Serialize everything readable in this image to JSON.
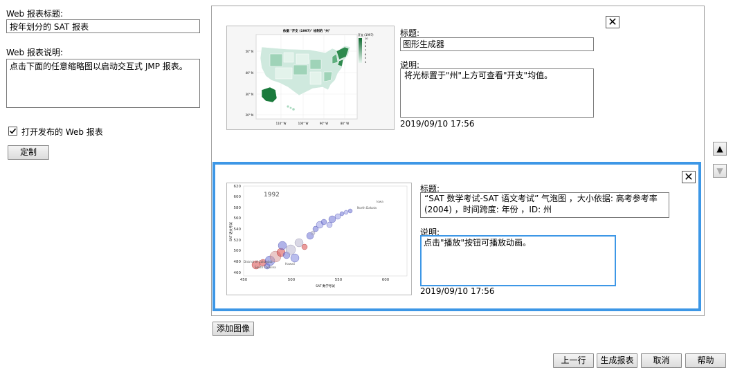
{
  "left": {
    "title_label": "Web 报表标题:",
    "title_value": "按年划分的 SAT 报表",
    "desc_label": "Web 报表说明:",
    "desc_value": "点击下面的任意缩略图以启动交互式 JMP 报表。",
    "open_checkbox_label": "打开发布的 Web 报表",
    "open_checked": true,
    "customize_button": "定制"
  },
  "cards": [
    {
      "title_label": "标题:",
      "title_value": "图形生成器",
      "desc_label": "说明:",
      "desc_value": "将光标置于\"州\"上方可查看\"开支\"均值。",
      "timestamp": "2019/09/10 17:56",
      "thumb_title": "依据 \"开支 (1997)\" 绘制的 \"州\"",
      "legend_title": "开支 (1997)",
      "legend_ticks": [
        "10",
        "9",
        "8",
        "7",
        "6",
        "5",
        "4"
      ],
      "lat_labels": [
        "50° N",
        "40° N",
        "30° N",
        "20° N"
      ],
      "lon_labels": [
        "110° W",
        "100° W",
        "90° W",
        "80° W"
      ]
    },
    {
      "title_label": "标题:",
      "title_value": "“SAT 数学考试-SAT 语文考试” 气泡图 ，大小依据: 高考参考率 (2004) ，时间跨度: 年份 ，ID: 州",
      "desc_label": "说明:",
      "desc_value": "点击\"播放\"按钮可播放动画。",
      "timestamp": "2019/09/10 17:56",
      "thumb_year": "1992",
      "x_ticks": [
        "450",
        "500",
        "550",
        "600"
      ],
      "y_ticks": [
        "620",
        "600",
        "580",
        "560",
        "540",
        "520",
        "500",
        "480",
        "460"
      ],
      "xlabel": "SAT 数学考试",
      "ylabel": "SAT 语文考试",
      "annotations": [
        "Iowa",
        "North Dakota",
        "Hawaii",
        "District of Columbia",
        "South Carolina"
      ]
    }
  ],
  "buttons": {
    "add_image": "添加图像",
    "prev": "上一行",
    "generate": "生成报表",
    "cancel": "取消",
    "help": "帮助",
    "close": "✕",
    "move_up": "▲",
    "move_down": "▼"
  },
  "colors": {
    "selection_border": "#3d97e6",
    "map_dark": "#1a7a3c",
    "bubble_blue": "#6f74d6",
    "bubble_red": "#d84a4a"
  }
}
